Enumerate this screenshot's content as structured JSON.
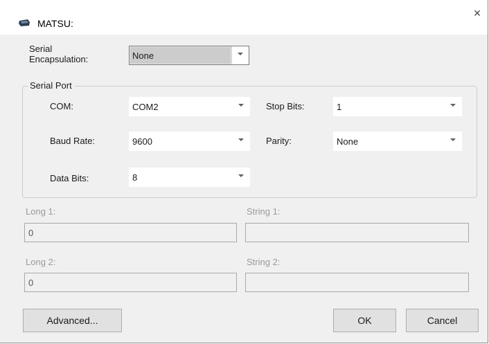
{
  "window": {
    "title": "MATSU:",
    "close_glyph": "×",
    "icon": "device-icon"
  },
  "encapsulation": {
    "label": "Serial\nEncapsulation:",
    "value": "None"
  },
  "serial_port": {
    "group_label": "Serial Port",
    "com": {
      "label": "COM:",
      "value": "COM2"
    },
    "baud_rate": {
      "label": "Baud Rate:",
      "value": "9600"
    },
    "data_bits": {
      "label": "Data Bits:",
      "value": "8"
    },
    "stop_bits": {
      "label": "Stop Bits:",
      "value": "1"
    },
    "parity": {
      "label": "Parity:",
      "value": "None"
    }
  },
  "params": {
    "long1": {
      "label": "Long 1:",
      "value": "0"
    },
    "string1": {
      "label": "String 1:",
      "value": ""
    },
    "long2": {
      "label": "Long 2:",
      "value": "0"
    },
    "string2": {
      "label": "String 2:",
      "value": ""
    }
  },
  "buttons": {
    "advanced": "Advanced...",
    "ok": "OK",
    "cancel": "Cancel"
  }
}
